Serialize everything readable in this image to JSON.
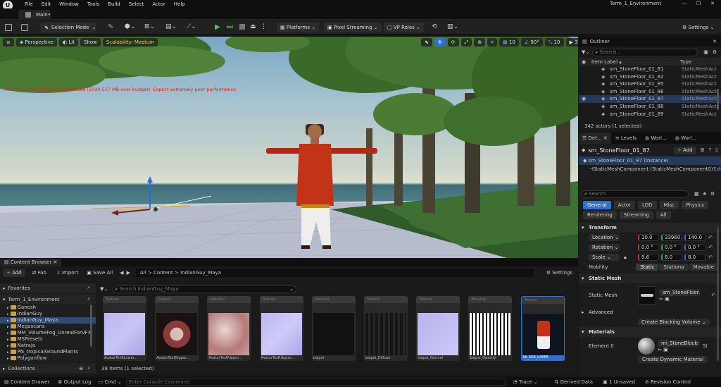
{
  "app": {
    "window_title": "Term_1_Environment",
    "menu": [
      "File",
      "Edit",
      "Window",
      "Tools",
      "Build",
      "Select",
      "Actor",
      "Help"
    ],
    "tab": "Main•"
  },
  "toolbar": {
    "selection_mode": "Selection Mode",
    "platforms": "Platforms",
    "pixel_streaming": "Pixel Streaming",
    "vp_roles": "VP Roles",
    "settings": "Settings"
  },
  "viewport": {
    "perspective": "Perspective",
    "lit": "Lit",
    "show": "Show",
    "scalability": "Scalability: Medium",
    "warning": "Video memory has been exhausted (5030.517 MB over budget). Expect extremely poor performance.",
    "grid_snap": "10",
    "rot_snap": "90°",
    "scale_snap": "10",
    "cam_speed": "3"
  },
  "outliner": {
    "title": "Outliner",
    "search_placeholder": "Search...",
    "col_label": "Item Label ▴",
    "col_type": "Type",
    "rows": [
      {
        "label": "sm_StoneFloor_01_81",
        "type": "StaticMeshActor"
      },
      {
        "label": "sm_StoneFloor_01_82",
        "type": "StaticMeshActor"
      },
      {
        "label": "sm_StoneFloor_01_85",
        "type": "StaticMeshActor"
      },
      {
        "label": "sm_StoneFloor_01_86",
        "type": "StaticMeshActor"
      },
      {
        "label": "sm_StoneFloor_01_87",
        "type": "StaticMeshActor"
      },
      {
        "label": "sm_StoneFloor_01_88",
        "type": "StaticMeshActor"
      },
      {
        "label": "sm_StoneFloor_01_89",
        "type": "StaticMeshActor"
      }
    ],
    "footer": "342 actors (1 selected)"
  },
  "details": {
    "tabs": [
      "Det...",
      "Levels",
      "Worl...",
      "Worl..."
    ],
    "actor_name": "sm_StoneFloor_01_87",
    "add": "Add",
    "instance": "sm_StoneFloor_01_87 (Instance)",
    "component": "StaticMeshComponent (StaticMeshComponent0)",
    "edit": "Edi",
    "search_placeholder": "Search",
    "filters_row1": [
      "General",
      "Actor",
      "LOD",
      "Misc",
      "Physics"
    ],
    "filters_row2": [
      "Rendering",
      "Streaming",
      "All"
    ],
    "transform": {
      "title": "Transform",
      "location": {
        "label": "Location",
        "x": "10.0",
        "y": "33960.0",
        "z": "140.0"
      },
      "rotation": {
        "label": "Rotation",
        "x": "0.0 °",
        "y": "0.0 °",
        "z": "0.0 °"
      },
      "scale": {
        "label": "Scale",
        "x": "9.6",
        "y": "8.0",
        "z": "8.0"
      },
      "mobility": {
        "label": "Mobility",
        "options": [
          "Static",
          "Stationa",
          "Movable"
        ]
      }
    },
    "static_mesh": {
      "title": "Static Mesh",
      "label": "Static Mesh",
      "value": "sm_StoneFloor..."
    },
    "advanced": {
      "title": "Advanced",
      "button": "Create Blocking Volume"
    },
    "materials": {
      "title": "Materials",
      "element": "Element 0",
      "value": "mi_StoneBlocks",
      "sl": "Sl",
      "button": "Create Dynamic Material"
    }
  },
  "content_browser": {
    "tab": "Content Browser",
    "add": "Add",
    "fab": "Fab",
    "import": "Import",
    "save_all": "Save All",
    "path": [
      "All",
      "Content",
      "IndianGuy_Maya"
    ],
    "settings": "Settings",
    "favorites": "Favorites",
    "collections": "Collections",
    "search_placeholder": "Search IndianGuy_Maya",
    "tree": [
      {
        "label": "Term_1_Environment",
        "level": 0
      },
      {
        "label": "Ganesh",
        "level": 1
      },
      {
        "label": "IndianGuy",
        "level": 1
      },
      {
        "label": "IndianGuy_Maya",
        "level": 1,
        "selected": true
      },
      {
        "label": "Megascans",
        "level": 1
      },
      {
        "label": "MM_VolumeFog_UnrealForVFX",
        "level": 1
      },
      {
        "label": "MSPresets",
        "level": 1
      },
      {
        "label": "Natraja",
        "level": 1
      },
      {
        "label": "PN_tropicalGroundPlants",
        "level": 1
      },
      {
        "label": "Polygonflow",
        "level": 1
      }
    ],
    "assets": [
      {
        "type": "Texture",
        "name": "AvatarTexRLower..."
      },
      {
        "type": "Texture",
        "name": "AvatarTexRUpper..."
      },
      {
        "type": "Material",
        "name": "AvatarTexRUpper..."
      },
      {
        "type": "Texture",
        "name": "AvatarTexRUpper..."
      },
      {
        "type": "Material",
        "name": "bajpai"
      },
      {
        "type": "Texture",
        "name": "bajpai_Diffuse"
      },
      {
        "type": "Texture",
        "name": "bajpai_Normal"
      },
      {
        "type": "Material",
        "name": "bajpai_Opacity"
      },
      {
        "type": "Texture",
        "name": "hk_SKE_LAYER"
      }
    ],
    "count": "38 items (1 selected)"
  },
  "statusbar": {
    "content_drawer": "Content Drawer",
    "output_log": "Output Log",
    "cmd": "Cmd",
    "console_placeholder": "Enter Console Command",
    "trace": "Trace",
    "derived_data": "Derived Data",
    "unsaved": "1 Unsaved",
    "revision_control": "Revision Control"
  }
}
